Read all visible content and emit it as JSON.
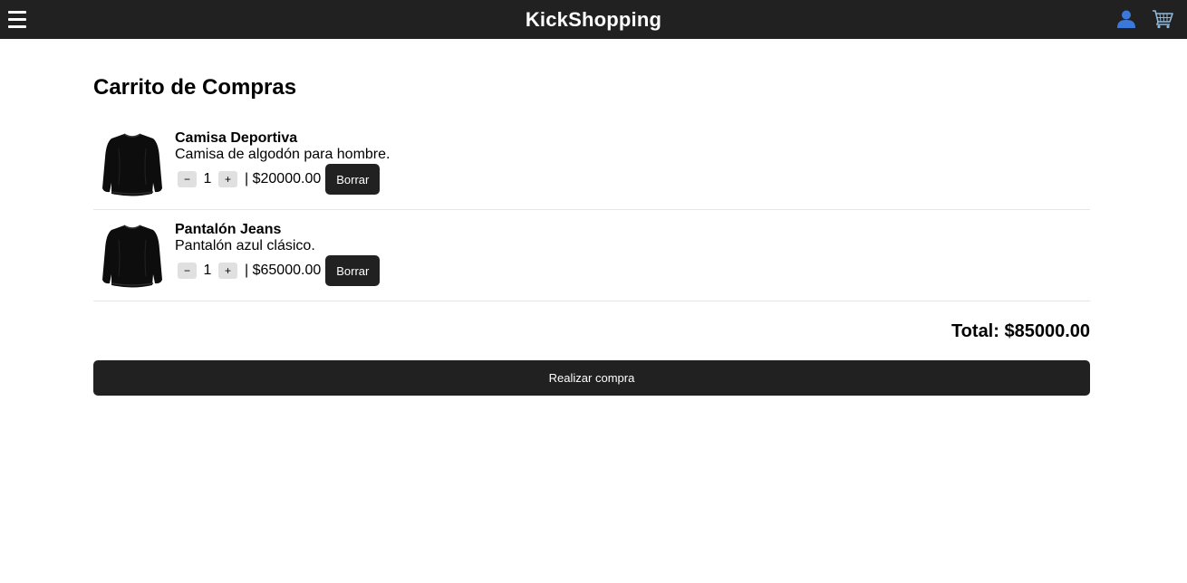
{
  "header": {
    "brand": "KickShopping",
    "menu_icon": "hamburger-menu-icon",
    "user_icon": "user-icon",
    "cart_icon": "shopping-cart-icon",
    "background_color": "#212121",
    "user_icon_color": "#3b78d8"
  },
  "page": {
    "title": "Carrito de Compras"
  },
  "cart": {
    "items": [
      {
        "name": "Camisa Deportiva",
        "description": "Camisa de algodón para hombre.",
        "decrement": "−",
        "quantity": "1",
        "increment": "+",
        "price": "| $20000.00",
        "delete_label": "Borrar",
        "image_icon": "sweater-image"
      },
      {
        "name": "Pantalón Jeans",
        "description": "Pantalón azul clásico.",
        "decrement": "−",
        "quantity": "1",
        "increment": "+",
        "price": "| $65000.00",
        "delete_label": "Borrar",
        "image_icon": "sweater-image"
      }
    ],
    "total": "Total: $85000.00",
    "checkout_label": "Realizar compra"
  }
}
